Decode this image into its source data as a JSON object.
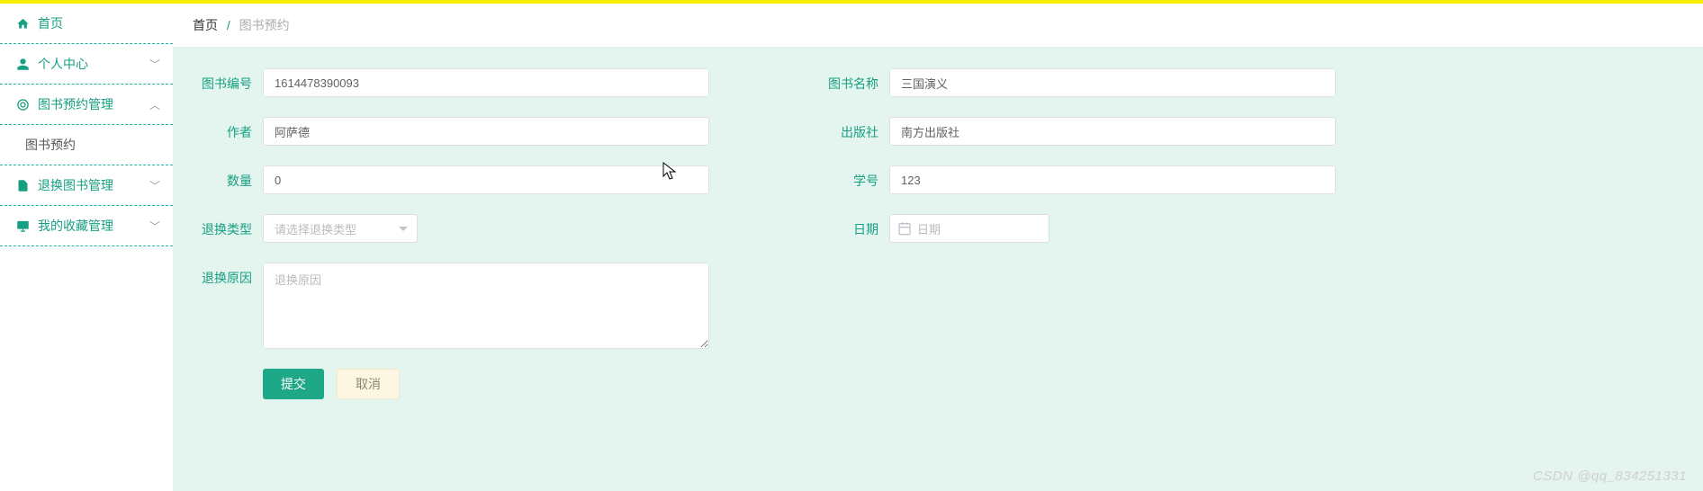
{
  "sidebar": {
    "items": [
      {
        "label": "首页",
        "icon": "home-icon"
      },
      {
        "label": "个人中心",
        "icon": "user-icon",
        "expand": "down"
      },
      {
        "label": "图书预约管理",
        "icon": "grid-icon",
        "expand": "up"
      },
      {
        "label": "图书预约",
        "sub": true
      },
      {
        "label": "退换图书管理",
        "icon": "file-icon",
        "expand": "down"
      },
      {
        "label": "我的收藏管理",
        "icon": "monitor-icon",
        "expand": "down"
      }
    ]
  },
  "breadcrumb": {
    "home": "首页",
    "sep": "/",
    "current": "图书预约"
  },
  "form": {
    "book_no": {
      "label": "图书编号",
      "value": "1614478390093"
    },
    "book_name": {
      "label": "图书名称",
      "value": "三国演义"
    },
    "author": {
      "label": "作者",
      "value": "阿萨德"
    },
    "publisher": {
      "label": "出版社",
      "value": "南方出版社"
    },
    "qty": {
      "label": "数量",
      "value": "0"
    },
    "student_no": {
      "label": "学号",
      "value": "123"
    },
    "return_type": {
      "label": "退换类型",
      "placeholder": "请选择退换类型"
    },
    "date": {
      "label": "日期",
      "placeholder": "日期"
    },
    "reason": {
      "label": "退换原因",
      "placeholder": "退换原因",
      "value": ""
    }
  },
  "buttons": {
    "submit": "提交",
    "cancel": "取消"
  },
  "watermark": "CSDN @qq_834251331"
}
